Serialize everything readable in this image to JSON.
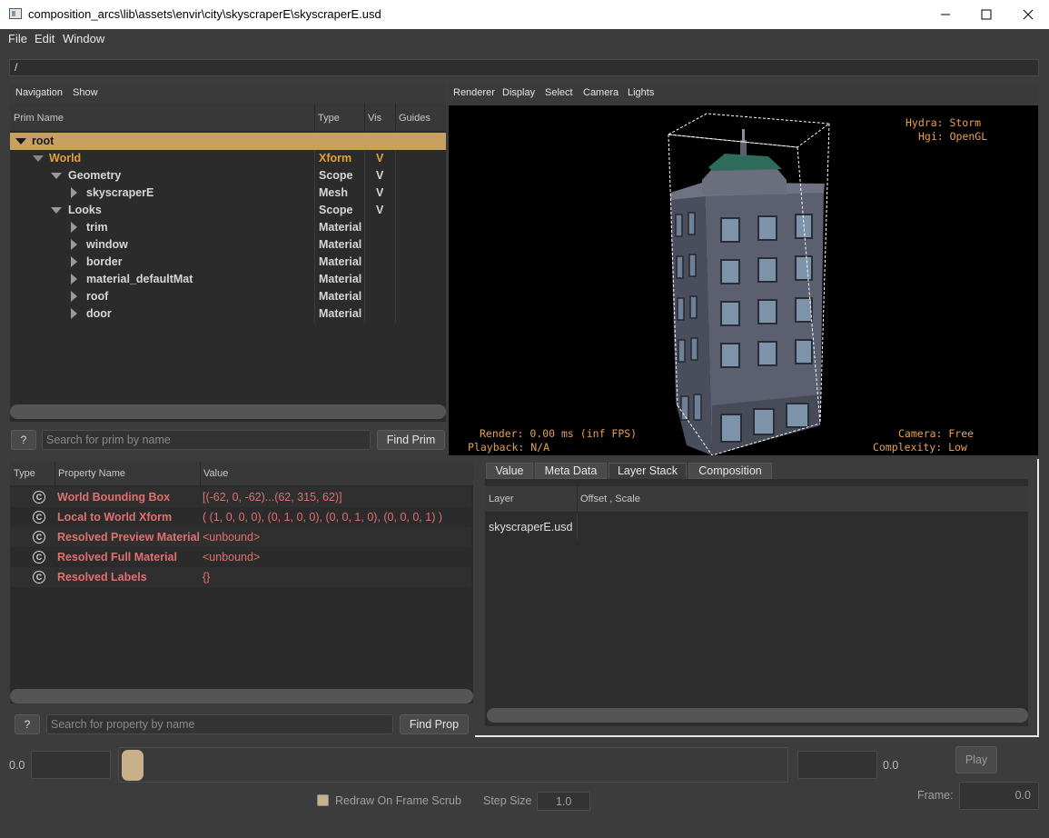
{
  "window": {
    "title": "composition_arcs\\lib\\assets\\envir\\city\\skyscraperE\\skyscraperE.usd"
  },
  "menu": [
    "File",
    "Edit",
    "Window"
  ],
  "path": "/",
  "prim_panel": {
    "header": [
      "Navigation",
      "Show"
    ],
    "columns": [
      "Prim Name",
      "Type",
      "Vis",
      "Guides"
    ],
    "rows": [
      {
        "name": "root",
        "type": "",
        "vis": ""
      },
      {
        "name": "World",
        "type": "Xform",
        "vis": "V"
      },
      {
        "name": "Geometry",
        "type": "Scope",
        "vis": "V"
      },
      {
        "name": "skyscraperE",
        "type": "Mesh",
        "vis": "V"
      },
      {
        "name": "Looks",
        "type": "Scope",
        "vis": "V"
      },
      {
        "name": "trim",
        "type": "Material",
        "vis": ""
      },
      {
        "name": "window",
        "type": "Material",
        "vis": ""
      },
      {
        "name": "border",
        "type": "Material",
        "vis": ""
      },
      {
        "name": "material_defaultMat",
        "type": "Material",
        "vis": ""
      },
      {
        "name": "roof",
        "type": "Material",
        "vis": ""
      },
      {
        "name": "door",
        "type": "Material",
        "vis": ""
      }
    ],
    "help_label": "?",
    "search_placeholder": "Search for prim by name",
    "find_label": "Find Prim"
  },
  "viewport": {
    "menu": [
      "Renderer",
      "Display",
      "Select",
      "Camera",
      "Lights"
    ],
    "hud_renderer": "Hydra: Storm",
    "hud_hgi": "Hgi: OpenGL",
    "hud_render": "Render: 0.00 ms (inf FPS)",
    "hud_playback": "Playback: N/A",
    "hud_camera": "Camera: Free",
    "hud_complexity": "Complexity: Low"
  },
  "property_panel": {
    "columns": [
      "Type",
      "Property Name",
      "Value"
    ],
    "rows": [
      {
        "icon": "C",
        "name": "World Bounding Box",
        "value": "[(-62, 0, -62)...(62, 315, 62)]"
      },
      {
        "icon": "C",
        "name": "Local to World Xform",
        "value": "( (1, 0, 0, 0), (0, 1, 0, 0), (0, 0, 1, 0), (0, 0, 0, 1) )"
      },
      {
        "icon": "C",
        "name": "Resolved Preview Material",
        "value": "<unbound>"
      },
      {
        "icon": "C",
        "name": "Resolved Full Material",
        "value": "<unbound>"
      },
      {
        "icon": "C",
        "name": "Resolved Labels",
        "value": "{}"
      }
    ],
    "help_label": "?",
    "search_placeholder": "Search for property by name",
    "find_label": "Find Prop"
  },
  "inspector": {
    "tabs": [
      "Value",
      "Meta Data",
      "Layer Stack",
      "Composition"
    ],
    "active_tab": "Layer Stack",
    "columns": [
      "Layer",
      "Offset , Scale"
    ],
    "rows": [
      {
        "layer": "skyscraperE.usd",
        "offset": ""
      }
    ]
  },
  "timeline": {
    "start_label": "0.0",
    "end_label": "0.0",
    "play_label": "Play",
    "redraw_label": "Redraw On Frame Scrub",
    "step_label": "Step Size",
    "step_value": "1.0",
    "frame_label": "Frame:",
    "frame_value": "0.0"
  },
  "colors": {
    "accent": "#e2a23a",
    "selection": "#c8a060",
    "property": "#e07070"
  }
}
